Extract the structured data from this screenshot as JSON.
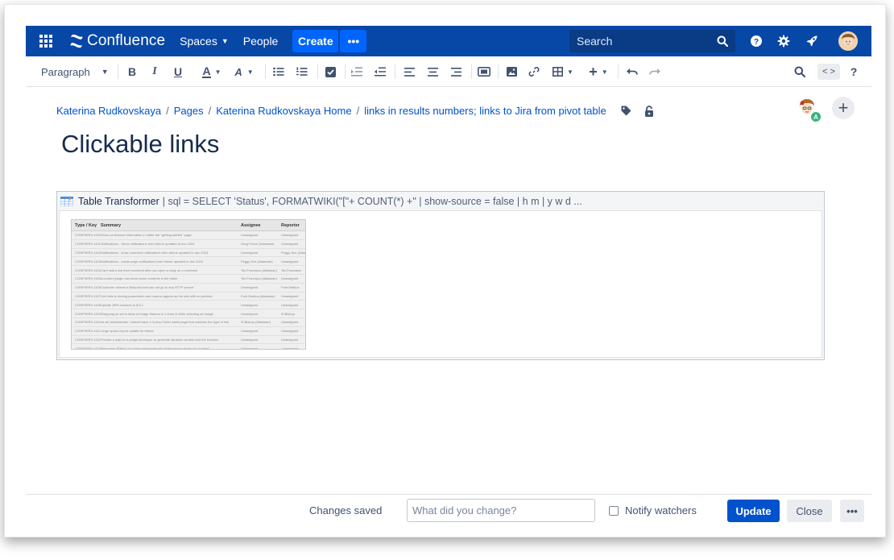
{
  "topnav": {
    "app_name": "Confluence",
    "spaces_label": "Spaces",
    "people_label": "People",
    "create_label": "Create",
    "more_label": "•••",
    "search_placeholder": "Search"
  },
  "toolbar": {
    "paragraph_label": "Paragraph",
    "bold": "B",
    "italic": "I",
    "underline": "U",
    "text_color": "A",
    "text_style": "A",
    "code_label": "< >",
    "help": "?"
  },
  "breadcrumb": {
    "items": [
      "Katerina Rudkovskaya",
      "Pages",
      "Katerina Rudkovskaya Home",
      "links in results numbers; links to Jira from pivot table"
    ]
  },
  "page": {
    "title": "Clickable links",
    "avatar_badge": "A",
    "add_label": "+"
  },
  "macro": {
    "name": "Table Transformer",
    "params": "| sql = SELECT 'Status', FORMATWIKI(\"[\"+ COUNT(*) +\" | show-source = false | h m | y w d ...",
    "preview": {
      "headers": [
        "Type / Key",
        "Summary",
        "Assignee",
        "Reporter"
      ],
      "rows": [
        [
          "CONFSERV-1100",
          "Show confluence information in editor the \"getting started\" page",
          "Unassigned",
          "Unassigned"
        ],
        [
          "CONFSERV-1101",
          "Notifications - Show notifications from theme updated at doc 2024",
          "Greg Prince (Atlassian)",
          "Unassigned"
        ],
        [
          "CONFSERV-1102",
          "Notifications - show comment notifications from theme updated in doc 2024",
          "Unassigned",
          "Peggy Sue (Atlassian)"
        ],
        [
          "CONFSERV-1103",
          "Notifications - Inside page notifications from theme updated in doc 2024",
          "Peggy Sue (Atlassian)",
          "Unassigned"
        ],
        [
          "CONFSERV-1104",
          "Can't add a top level comment after you open a reply on a comment",
          "Ted Francisco (Atlassian)",
          "Ted Francisco"
        ],
        [
          "CONFSERV-1105",
          "A content plugin can block some contents in the editor",
          "Ted Francisco (Atlassian)",
          "Unassigned"
        ],
        [
          "CONFSERV-1106",
          "Customer selects a Blueprint and can not go to any HTTP source",
          "Unassigned",
          "Fred Markus"
        ],
        [
          "CONFSERV-1107",
          "Link fails to storing parameters and macros appear as the wiki with no preview",
          "Fred Markus (Atlassian)",
          "Unassigned"
        ],
        [
          "CONFSERV-1108",
          "Update JIRA versions to 8.5.1",
          "Unassigned",
          "Unassigned"
        ],
        [
          "CONFSERV-1109",
          "Wrapping as set in table of Image Macros in 1 chart & while selecting an image",
          "Unassigned",
          "Si Bishop"
        ],
        [
          "CONFSERV-1110",
          "As an administrator I should have a 3-step Child Labels page that matches the type of link",
          "Si Bishop (Atlassian)",
          "Unassigned"
        ],
        [
          "CONFSERV-1111",
          "Large space export update for theme",
          "Unassigned",
          "Unassigned"
        ],
        [
          "CONFSERV-1112",
          "Provide a way for a plugin developer to generate dynamic content and the browser",
          "Unassigned",
          "Unassigned"
        ],
        [
          "CONFSERV-1113",
          "Removing \"Editor\" at a view page leads into when privacy blank out on label",
          "Unassigned",
          "Unassigned"
        ],
        [
          "CONFSERV-1114",
          "Fixed 3 admin groups view for a slow diff diagram at PHO",
          "Unassigned",
          "Alexander K."
        ]
      ]
    }
  },
  "footer": {
    "saved_label": "Changes saved",
    "change_placeholder": "What did you change?",
    "notify_label": "Notify watchers",
    "update_label": "Update",
    "close_label": "Close",
    "more_label": "•••"
  },
  "colors": {
    "nav": "#0747A6",
    "primary": "#0052CC",
    "create": "#0065FF",
    "text": "#172B4D",
    "subtle": "#42526E"
  }
}
